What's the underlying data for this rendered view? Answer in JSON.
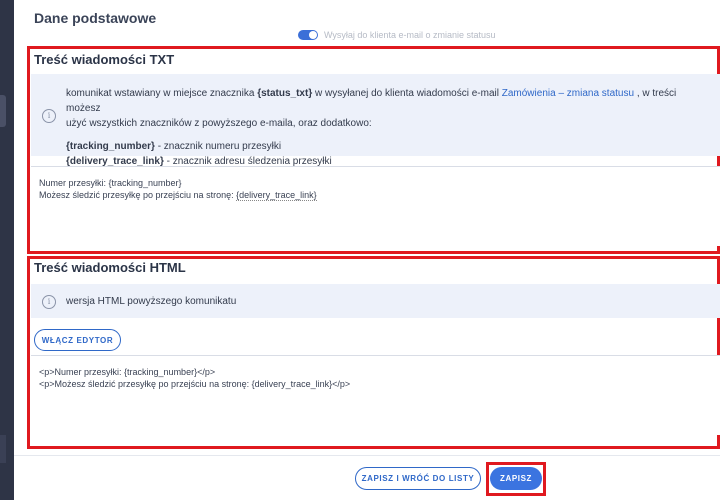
{
  "header": {
    "section_title": "Dane podstawowe",
    "toggle_label": "Wysyłaj do klienta e-mail o zmianie statusu"
  },
  "txt_section": {
    "title": "Treść wiadomości TXT",
    "info_pre": "komunikat wstawiany w miejsce znacznika ",
    "info_tag": "{status_txt}",
    "info_mid": " w wysyłanej do klienta wiadomości e-mail ",
    "info_link": "Zamówienia – zmiana statusu",
    "info_post": " , w treści możesz",
    "info_line2": "użyć wszystkich znaczników z powyższego e-maila, oraz dodatkowo:",
    "tag1": "{tracking_number}",
    "tag1_desc": " - znacznik numeru przesyłki",
    "tag2": "{delivery_trace_link}",
    "tag2_desc": " - znacznik adresu śledzenia przesyłki",
    "content_line1": "Numer przesyłki: {tracking_number}",
    "content_line2_pre": "Możesz śledzić przesyłkę po przejściu na stronę: ",
    "content_line2_tag": "{delivery_trace_link}"
  },
  "html_section": {
    "title": "Treść wiadomości HTML",
    "info": "wersja HTML powyższego komunikatu",
    "enable_editor": "WŁĄCZ EDYTOR",
    "content_line1": "<p>Numer przesyłki: {tracking_number}</p>",
    "content_line2": "<p>Możesz śledzić przesyłkę po przejściu na stronę: {delivery_trace_link}</p>"
  },
  "footer": {
    "save_back": "ZAPISZ I WRÓĆ DO LISTY",
    "save": "ZAPISZ"
  },
  "colors": {
    "accent": "#3b74e0",
    "highlight_border": "#e0191f",
    "info_bg": "#edf1fa",
    "sidebar": "#2e3446"
  }
}
